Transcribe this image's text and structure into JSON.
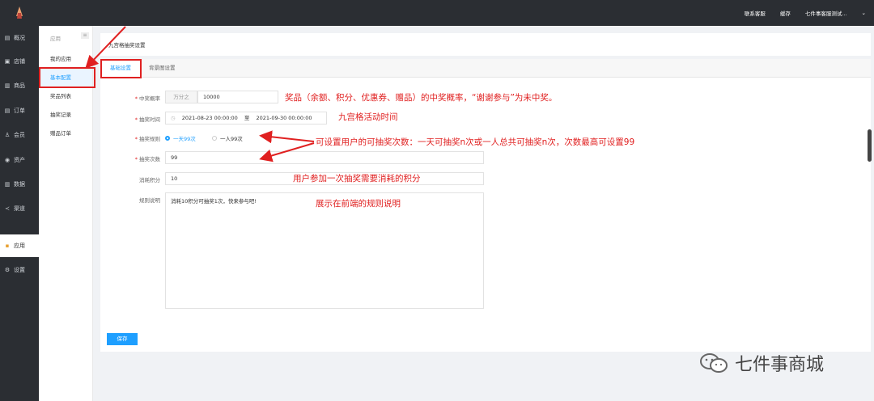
{
  "topbar": {
    "links": [
      "联系客服",
      "缓存",
      "七件事客服测试...",
      "⌄"
    ]
  },
  "leftnav": {
    "items": [
      {
        "icon": "▤",
        "label": "概况"
      },
      {
        "icon": "▣",
        "label": "店铺"
      },
      {
        "icon": "▥",
        "label": "商品"
      },
      {
        "icon": "▤",
        "label": "订单"
      },
      {
        "icon": "♙",
        "label": "会员"
      },
      {
        "icon": "◉",
        "label": "资产"
      },
      {
        "icon": "▥",
        "label": "数据"
      },
      {
        "icon": "≺",
        "label": "渠道"
      },
      {
        "icon": "▪",
        "label": "应用"
      },
      {
        "icon": "⚙",
        "label": "设置"
      }
    ]
  },
  "subnav": {
    "title": "应用",
    "toggle": "≡",
    "items": [
      "我的应用",
      "基本配置",
      "奖品列表",
      "抽奖记录",
      "赠品订单"
    ]
  },
  "page": {
    "title": "九宫格抽奖设置",
    "tabs": [
      "基础设置",
      "背景图设置"
    ]
  },
  "form": {
    "prob_label": "中奖概率",
    "prob_addon": "万分之",
    "prob_value": "10000",
    "time_label": "抽奖时间",
    "time_start": "2021-08-23 00:00:00",
    "time_sep": "至",
    "time_end": "2021-09-30 00:00:00",
    "rule_label": "抽奖规则",
    "rule_opt1": "一天99次",
    "rule_opt2": "一人99次",
    "count_label": "抽奖次数",
    "count_value": "99",
    "points_label": "消耗积分",
    "points_value": "10",
    "desc_label": "规则说明",
    "desc_value": "消耗10积分可抽奖1次，快来参与吧!",
    "save": "保存"
  },
  "notes": {
    "n1": "奖品（余额、积分、优惠券、赠品）的中奖概率，“谢谢参与”为未中奖。",
    "n2": "九宫格活动时间",
    "n3": "可设置用户的可抽奖次数：一天可抽奖n次或一人总共可抽奖n次，次数最高可设置99",
    "n4": "用户参加一次抽奖需要消耗的积分",
    "n5": "展示在前端的规则说明"
  },
  "watermark": "七件事商城",
  "colors": {
    "accent": "#1e9fff",
    "annotation": "#e02020",
    "sidebar": "#2b2e33"
  }
}
